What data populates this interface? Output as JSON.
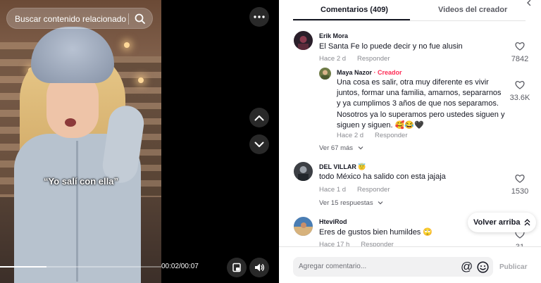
{
  "video": {
    "search_placeholder": "Buscar contenido relacionado",
    "caption": "“Yo salí con ella”",
    "time": "00:02/00:07",
    "progress": 0.29,
    "icons": [
      "search-icon",
      "more-icon",
      "chevron-up-icon",
      "chevron-down-icon",
      "picture-in-picture-icon",
      "volume-icon"
    ]
  },
  "tabs": {
    "comments": "Comentarios (409)",
    "creator_videos": "Videos del creador"
  },
  "comments": [
    {
      "user": "Erik Mora",
      "text": "El Santa Fe lo puede decir y no fue alusin",
      "age": "Hace 2 d",
      "reply": "Responder",
      "likes": "7842",
      "avatar_color": "#2a1f2a"
    },
    {
      "user": "Maya Nazor",
      "creator_label": "· Creador",
      "text": "Una cosa es salir, otra muy diferente es vivir juntos, formar una familia, amarnos, separarnos y ya cumplimos 3 años de que nos separamos. Nosotros ya lo superamos pero ustedes siguen y siguen y siguen. 🥰😂🖤",
      "age": "Hace 2 d",
      "reply": "Responder",
      "likes": "33.6K",
      "avatar_color": "#6d7a45"
    },
    {
      "user": "DEL VILLAR",
      "badge": "😇",
      "text": "todo México ha salido con esta jajaja",
      "age": "Hace 1 d",
      "reply": "Responder",
      "likes": "1530",
      "avatar_color": "#3c3f44"
    },
    {
      "user": "HteviRod",
      "text": "Eres de gustos bien humildes 🙄",
      "age": "Hace 17 h",
      "reply": "Responder",
      "likes": "31",
      "avatar_color": "#4a7db3"
    }
  ],
  "view_replies_1": "Ver 67 más",
  "view_replies_2": "Ver 15 respuestas",
  "back_to_top": "Volver arriba",
  "footer": {
    "placeholder": "Agregar comentario...",
    "publish": "Publicar"
  },
  "colors": {
    "accent": "#fe2c55",
    "text": "#161823",
    "muted": "#8a8b91"
  }
}
